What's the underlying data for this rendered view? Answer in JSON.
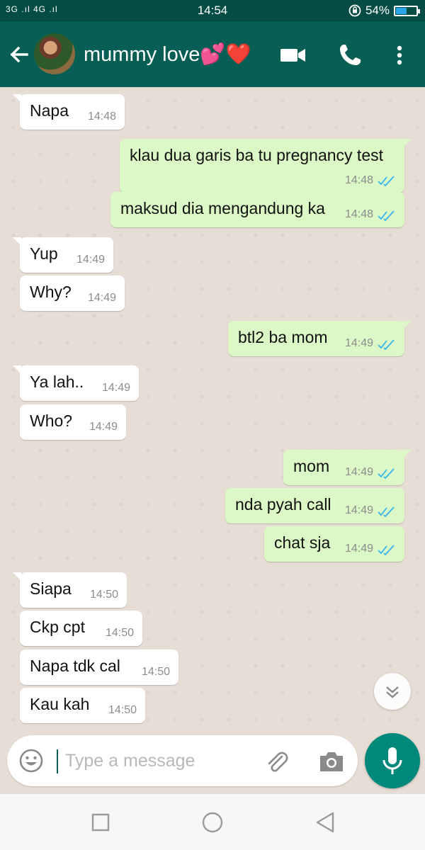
{
  "status_bar": {
    "network": "3G .ıl 4G .ıl",
    "time": "14:54",
    "battery_percent": "54%",
    "battery_level": 0.54
  },
  "header": {
    "contact_name": "mummy love💕❤️",
    "icons": [
      "back-arrow-icon",
      "video-call-icon",
      "phone-icon",
      "more-vert-icon"
    ]
  },
  "messages": [
    {
      "dir": "in",
      "text": "Napa",
      "time": "14:48"
    },
    {
      "dir": "out",
      "text": "klau dua garis ba tu pregnancy test",
      "time": "14:48"
    },
    {
      "dir": "out",
      "text": "maksud dia mengandung ka",
      "time": "14:48"
    },
    {
      "dir": "in",
      "text": "Yup",
      "time": "14:49"
    },
    {
      "dir": "in",
      "text": "Why?",
      "time": "14:49"
    },
    {
      "dir": "out",
      "text": "btl2 ba mom",
      "time": "14:49"
    },
    {
      "dir": "in",
      "text": "Ya lah..",
      "time": "14:49"
    },
    {
      "dir": "in",
      "text": "Who?",
      "time": "14:49"
    },
    {
      "dir": "out",
      "text": "mom",
      "time": "14:49"
    },
    {
      "dir": "out",
      "text": "nda pyah call",
      "time": "14:49"
    },
    {
      "dir": "out",
      "text": "chat sja",
      "time": "14:49"
    },
    {
      "dir": "in",
      "text": "Siapa",
      "time": "14:50"
    },
    {
      "dir": "in",
      "text": "Ckp cpt",
      "time": "14:50"
    },
    {
      "dir": "in",
      "text": "Napa tdk cal",
      "time": "14:50"
    },
    {
      "dir": "in",
      "text": "Kau kah",
      "time": "14:50"
    }
  ],
  "input": {
    "placeholder": "Type a message"
  },
  "colors": {
    "header": "#075e54",
    "status_bar": "#054d44",
    "outgoing_bubble": "#dcf8c6",
    "incoming_bubble": "#ffffff",
    "read_ticks": "#34b7f1",
    "mic_button": "#00897b"
  }
}
